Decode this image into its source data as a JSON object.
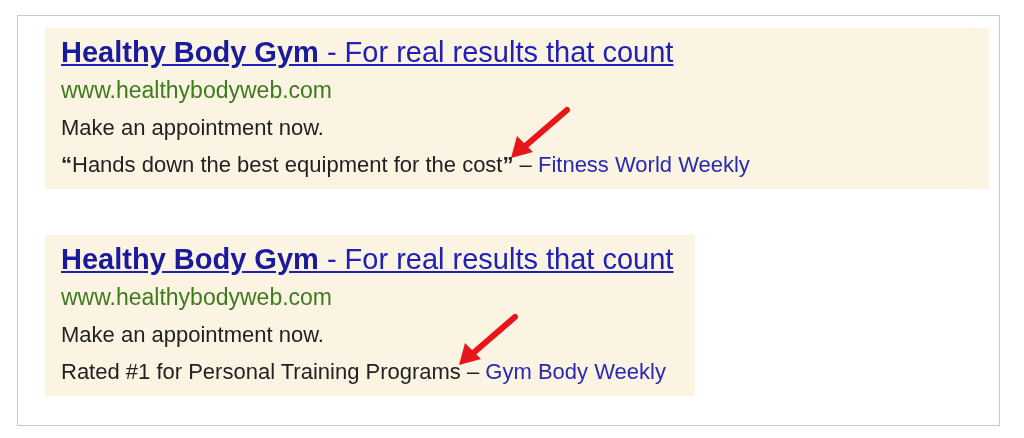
{
  "ads": [
    {
      "title": "**Healthy Body Gym** - For real results that count",
      "url": "www.healthybodyweb.com",
      "description": "Make an appointment now.",
      "review": {
        "text": "**“**Hands down the best equipment for the cost**”**",
        "separator": "–",
        "source": "Fitness World Weekly"
      }
    },
    {
      "title": "**Healthy Body Gym** - For real results that count",
      "url": "www.healthybodyweb.com",
      "description": "Make an appointment now.",
      "review": {
        "text": "Rated #1 for Personal Training Programs",
        "separator": "–",
        "source": "Gym Body Weekly"
      }
    }
  ]
}
